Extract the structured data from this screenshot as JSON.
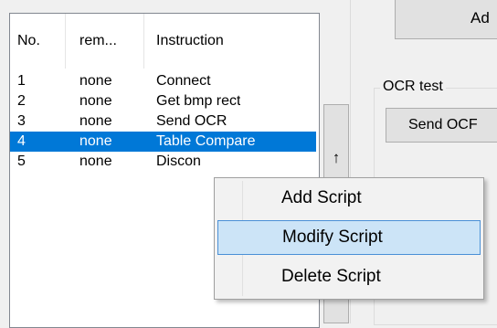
{
  "listview": {
    "columns": [
      "No.",
      "rem...",
      "Instruction"
    ],
    "rows": [
      {
        "no": "1",
        "rem": "none",
        "instruction": "Connect",
        "selected": false
      },
      {
        "no": "2",
        "rem": "none",
        "instruction": "Get bmp rect",
        "selected": false
      },
      {
        "no": "3",
        "rem": "none",
        "instruction": "Send OCR",
        "selected": false
      },
      {
        "no": "4",
        "rem": "none",
        "instruction": "Table Compare",
        "selected": true
      },
      {
        "no": "5",
        "rem": "none",
        "instruction": "Discon",
        "selected": false
      }
    ]
  },
  "up_button": {
    "label": "↑"
  },
  "top_button": {
    "label": "Ad"
  },
  "ocr_group": {
    "title": "OCR test",
    "button_label": "Send OCF"
  },
  "context_menu": {
    "items": [
      "Add Script",
      "Modify Script",
      "Delete Script"
    ],
    "hovered_index": 1
  },
  "colors": {
    "selection": "#0078d7",
    "menu_hover": "#cce4f7",
    "menu_hover_border": "#4a90d6"
  }
}
